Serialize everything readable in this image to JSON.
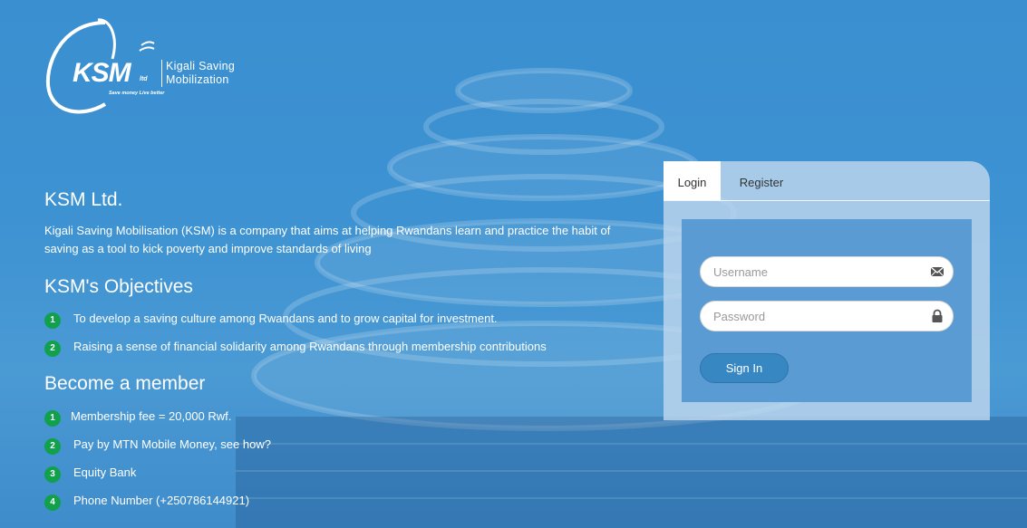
{
  "logo": {
    "mark": "KSM",
    "ltd": "ltd",
    "tagline": "Save money Live better",
    "name_line1": "Kigali Saving",
    "name_line2": "Mobilization"
  },
  "company": {
    "title": "KSM Ltd.",
    "intro": "Kigali Saving Mobilisation (KSM) is a company that aims at helping Rwandans learn and practice the habit of saving as a tool to kick poverty and improve standards of living"
  },
  "objectives": {
    "title": "KSM's Objectives",
    "items": [
      {
        "num": "1",
        "text": "To develop a saving culture among Rwandans and to grow capital for investment."
      },
      {
        "num": "2",
        "text": "Raising a sense of financial solidarity among Rwandans through membership contributions"
      }
    ]
  },
  "member": {
    "title": "Become a member",
    "items": [
      {
        "num": "1",
        "text": "Membership fee = 20,000 Rwf."
      },
      {
        "num": "2",
        "text": "Pay by MTN Mobile Money, see how?"
      },
      {
        "num": "3",
        "text": "Equity Bank"
      },
      {
        "num": "4",
        "text": "Phone Number (+250786144921)"
      }
    ]
  },
  "auth": {
    "tabs": [
      {
        "label": "Login",
        "active": true
      },
      {
        "label": "Register",
        "active": false
      }
    ],
    "username_placeholder": "Username",
    "username_icon": "envelope-icon",
    "password_placeholder": "Password",
    "password_icon": "lock-icon",
    "signin_label": "Sign In"
  },
  "colors": {
    "background": "#3d92d2",
    "badge": "#11a04c",
    "button": "#3787c3",
    "form_panel": "#5a9bd4"
  }
}
